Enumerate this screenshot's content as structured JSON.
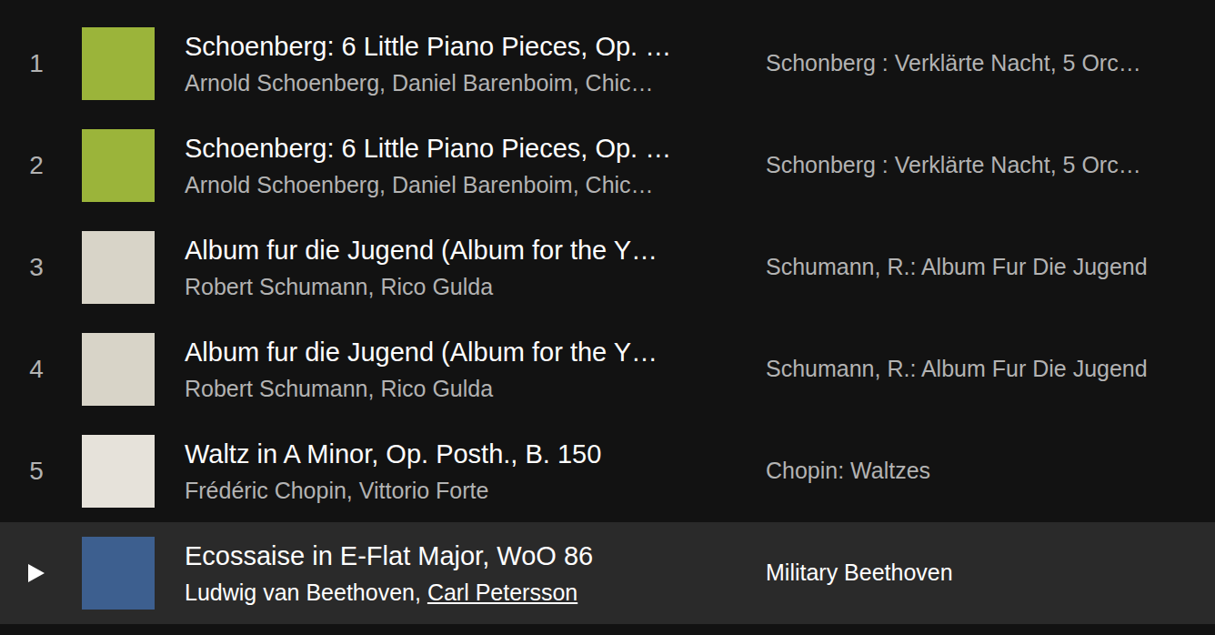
{
  "artist_separator": ", ",
  "tracks": [
    {
      "number": "1",
      "hovered": false,
      "title": "Schoenberg: 6 Little Piano Pieces, Op. …",
      "artists": [
        {
          "name": "Arnold Schoenberg",
          "hovered": false
        },
        {
          "name": "Daniel Barenboim",
          "hovered": false
        },
        {
          "name": "Chic…",
          "hovered": false
        }
      ],
      "album": "Schonberg : Verklärte Nacht, 5 Orc…",
      "color": "#9bb43a"
    },
    {
      "number": "2",
      "hovered": false,
      "title": "Schoenberg: 6 Little Piano Pieces, Op. …",
      "artists": [
        {
          "name": "Arnold Schoenberg",
          "hovered": false
        },
        {
          "name": "Daniel Barenboim",
          "hovered": false
        },
        {
          "name": "Chic…",
          "hovered": false
        }
      ],
      "album": "Schonberg : Verklärte Nacht, 5 Orc…",
      "color": "#9bb43a"
    },
    {
      "number": "3",
      "hovered": false,
      "title": "Album fur die Jugend (Album for the Y…",
      "artists": [
        {
          "name": "Robert Schumann",
          "hovered": false
        },
        {
          "name": "Rico Gulda",
          "hovered": false
        }
      ],
      "album": "Schumann, R.: Album Fur Die Jugend",
      "color": "#d8d4c8"
    },
    {
      "number": "4",
      "hovered": false,
      "title": "Album fur die Jugend (Album for the Y…",
      "artists": [
        {
          "name": "Robert Schumann",
          "hovered": false
        },
        {
          "name": "Rico Gulda",
          "hovered": false
        }
      ],
      "album": "Schumann, R.: Album Fur Die Jugend",
      "color": "#d8d4c8"
    },
    {
      "number": "5",
      "hovered": false,
      "title": "Waltz in A Minor, Op. Posth., B. 150",
      "artists": [
        {
          "name": "Frédéric Chopin",
          "hovered": false
        },
        {
          "name": "Vittorio Forte",
          "hovered": false
        }
      ],
      "album": "Chopin: Waltzes",
      "color": "#e6e2da"
    },
    {
      "number": "",
      "hovered": true,
      "title": "Ecossaise in E-Flat Major, WoO 86",
      "artists": [
        {
          "name": "Ludwig van Beethoven",
          "hovered": false
        },
        {
          "name": "Carl Petersson",
          "hovered": true
        }
      ],
      "album": "Military Beethoven",
      "color": "#3d5f8f"
    }
  ]
}
